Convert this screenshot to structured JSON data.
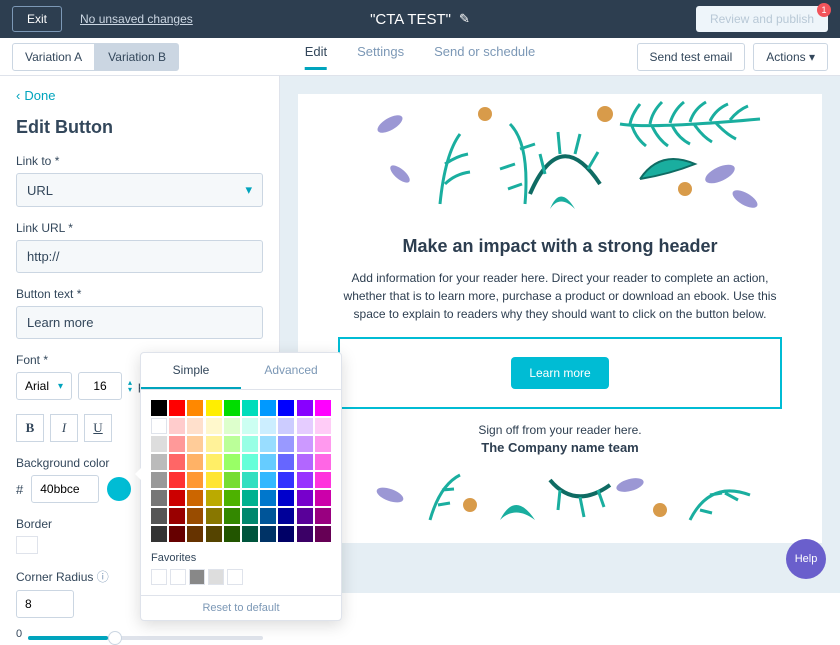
{
  "topbar": {
    "exit": "Exit",
    "status": "No unsaved changes",
    "title": "\"CTA TEST\"",
    "review": "Review and publish",
    "badge": "1"
  },
  "variations": {
    "a": "Variation A",
    "b": "Variation B"
  },
  "tabs": {
    "edit": "Edit",
    "settings": "Settings",
    "send": "Send or schedule"
  },
  "actions": {
    "test": "Send test email",
    "menu": "Actions"
  },
  "done": "Done",
  "panel": {
    "title": "Edit Button",
    "link_to_lbl": "Link to *",
    "link_to": "URL",
    "link_url_lbl": "Link URL *",
    "link_url": "http://",
    "btn_text_lbl": "Button text *",
    "btn_text": "Learn more",
    "font_lbl": "Font *",
    "font": "Arial",
    "size": "16",
    "unit": "p",
    "bg_lbl": "Background color",
    "bg_hex": "40bbce",
    "border_lbl": "Border",
    "radius_lbl": "Corner Radius",
    "radius": "8",
    "slider_min": "0"
  },
  "colorpicker": {
    "simple": "Simple",
    "advanced": "Advanced",
    "colors": [
      "#000000",
      "#ff0000",
      "#ff8800",
      "#ffee00",
      "#00dd00",
      "#00ddbb",
      "#0099ff",
      "#0000ff",
      "#8800ff",
      "#ff00ff",
      "#ffffff",
      "#ffcccc",
      "#ffe0cc",
      "#fff8cc",
      "#ddffcc",
      "#ccfff2",
      "#cceeff",
      "#ccccff",
      "#e5ccff",
      "#ffccf7",
      "#dddddd",
      "#ff9999",
      "#ffcc99",
      "#fff299",
      "#bbff99",
      "#99ffe5",
      "#99ddff",
      "#9999ff",
      "#cc99ff",
      "#ff99ee",
      "#bbbbbb",
      "#ff6666",
      "#ffb266",
      "#ffee66",
      "#99ff66",
      "#66ffd9",
      "#66ccff",
      "#6666ff",
      "#b266ff",
      "#ff66e5",
      "#999999",
      "#ff3333",
      "#ff9933",
      "#ffe533",
      "#77dd33",
      "#33dfc0",
      "#33b8ff",
      "#3333ff",
      "#9933ff",
      "#ff33dd",
      "#777777",
      "#cc0000",
      "#cc6600",
      "#bbaa00",
      "#4db200",
      "#00b290",
      "#0077cc",
      "#0000cc",
      "#7700cc",
      "#cc00aa",
      "#555555",
      "#990000",
      "#994c00",
      "#887700",
      "#338800",
      "#00886d",
      "#005599",
      "#000099",
      "#590099",
      "#990080",
      "#333333",
      "#660000",
      "#663300",
      "#554400",
      "#225500",
      "#00553d",
      "#003366",
      "#000066",
      "#3b0066",
      "#660055"
    ],
    "fav_lbl": "Favorites",
    "favorites": [
      "#ffffff",
      "#ffffff",
      "#888888",
      "#dddddd",
      "#ffffff"
    ],
    "reset": "Reset to default"
  },
  "preview": {
    "header": "Make an impact with a strong header",
    "body": "Add information for your reader here. Direct your reader to complete an action, whether that is to learn more, purchase a product or download an ebook. Use this space to explain to readers why they should want to click on the button below.",
    "cta": "Learn more",
    "signoff": "Sign off from your reader here.",
    "company": "The Company name team"
  },
  "help": "Help"
}
